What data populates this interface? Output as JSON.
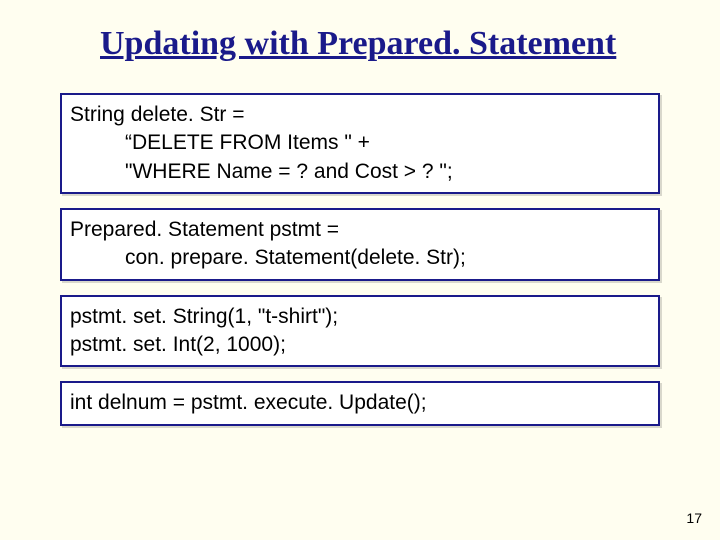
{
  "title": "Updating with Prepared. Statement",
  "boxes": [
    {
      "lines": [
        {
          "text": "String delete. Str =",
          "indent": false
        },
        {
          "text": "“DELETE FROM Items \" +",
          "indent": true
        },
        {
          "text": "\"WHERE Name = ? and Cost > ? \";",
          "indent": true
        }
      ]
    },
    {
      "lines": [
        {
          "text": "Prepared. Statement pstmt =",
          "indent": false
        },
        {
          "text": "con. prepare. Statement(delete. Str);",
          "indent": true
        }
      ]
    },
    {
      "lines": [
        {
          "text": "pstmt. set. String(1, \"t-shirt\");",
          "indent": false
        },
        {
          "text": "pstmt. set. Int(2, 1000);",
          "indent": false
        }
      ]
    },
    {
      "lines": [
        {
          "text": "int delnum = pstmt. execute. Update();",
          "indent": false
        }
      ]
    }
  ],
  "page_number": "17"
}
